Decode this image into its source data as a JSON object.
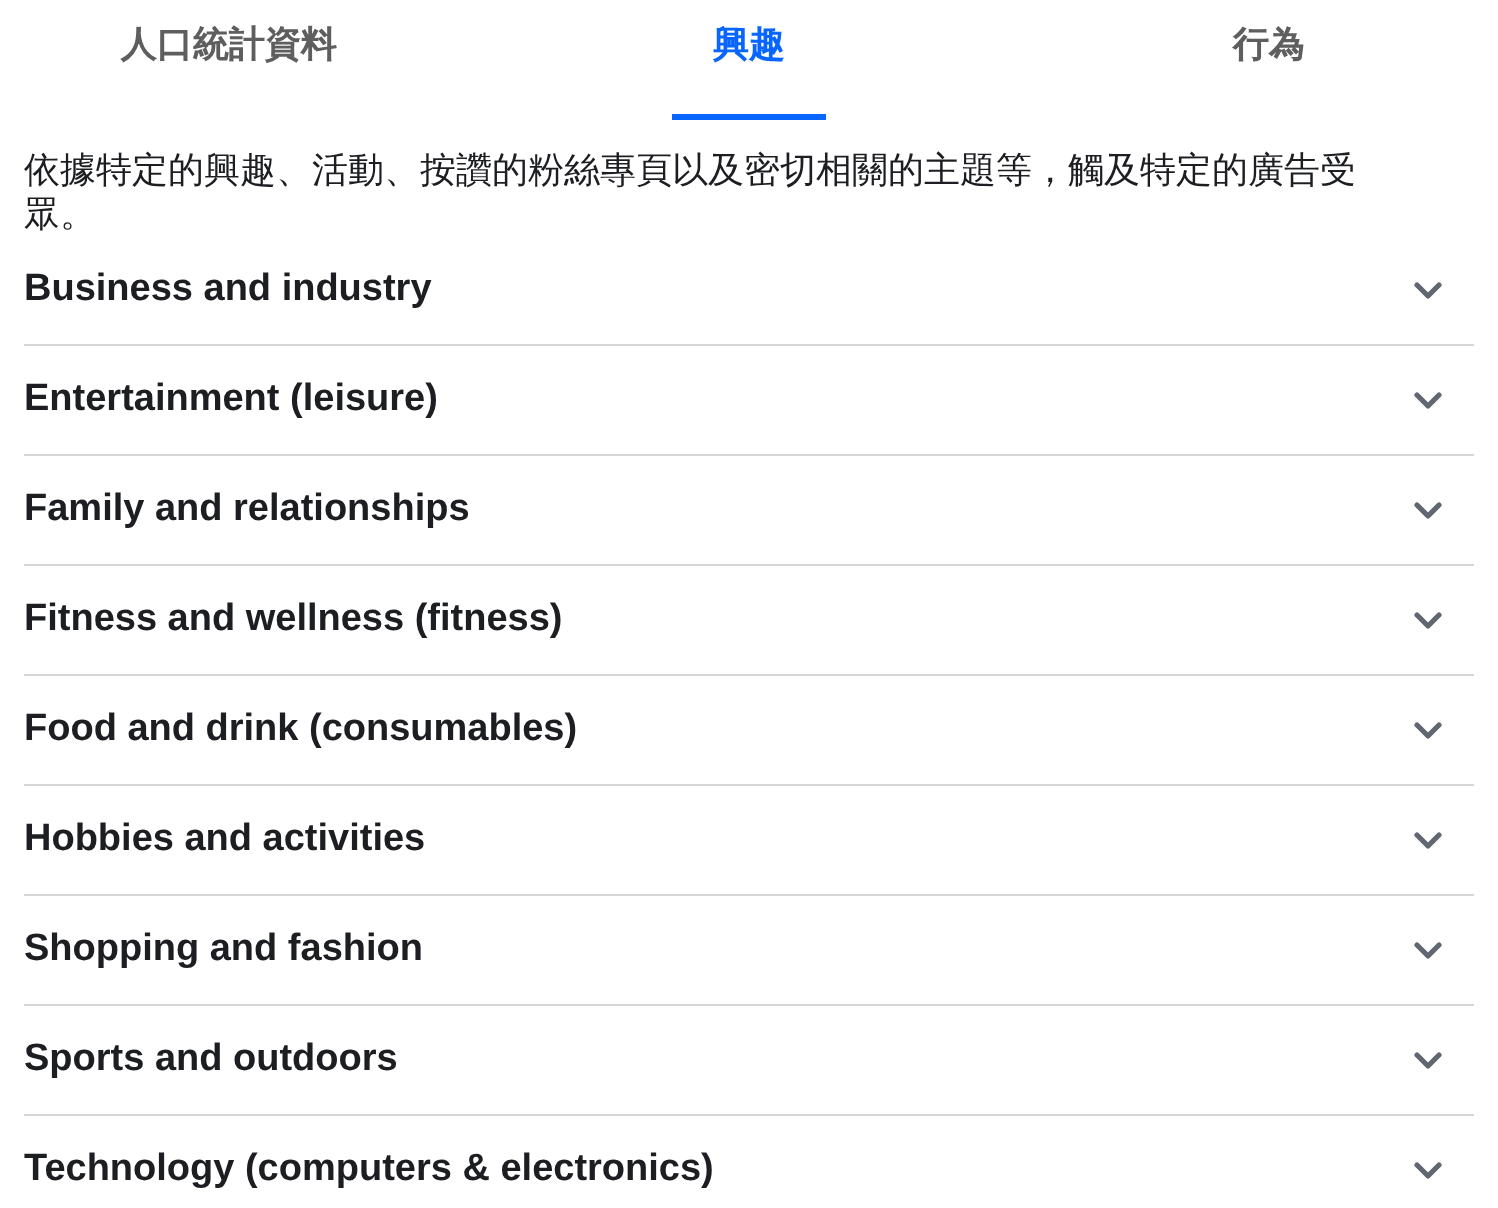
{
  "tabs": [
    {
      "label": "人口統計資料",
      "selected": false
    },
    {
      "label": "興趣",
      "selected": true
    },
    {
      "label": "行為",
      "selected": false
    }
  ],
  "description": "依據特定的興趣、活動、按讚的粉絲專頁以及密切相關的主題等，觸及特定的廣告受眾。",
  "categories": [
    {
      "label": "Business and industry",
      "expanded": false
    },
    {
      "label": "Entertainment (leisure)",
      "expanded": false
    },
    {
      "label": "Family and relationships",
      "expanded": false
    },
    {
      "label": "Fitness and wellness (fitness)",
      "expanded": false
    },
    {
      "label": "Food and drink (consumables)",
      "expanded": false
    },
    {
      "label": "Hobbies and activities",
      "expanded": false
    },
    {
      "label": "Shopping and fashion",
      "expanded": false
    },
    {
      "label": "Sports and outdoors",
      "expanded": false
    },
    {
      "label": "Technology (computers & electronics)",
      "expanded": false
    }
  ]
}
